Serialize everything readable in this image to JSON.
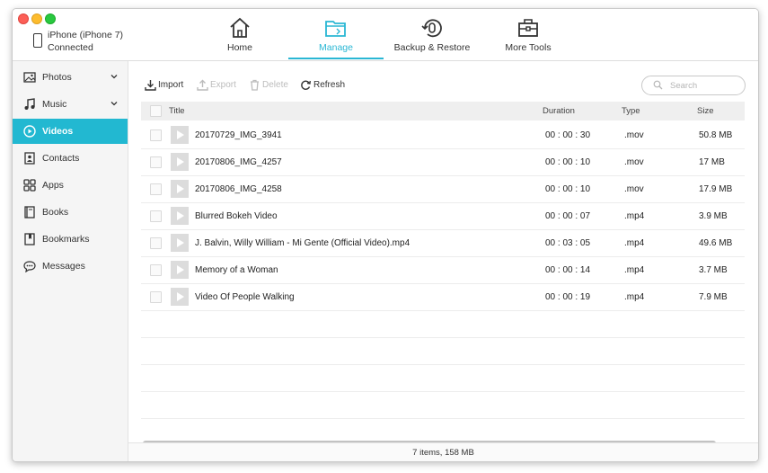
{
  "device": {
    "name": "iPhone (iPhone 7)",
    "status": "Connected"
  },
  "nav_tabs": [
    {
      "label": "Home",
      "icon": "home-icon"
    },
    {
      "label": "Manage",
      "icon": "folder-icon",
      "active": true
    },
    {
      "label": "Backup & Restore",
      "icon": "backup-restore-icon"
    },
    {
      "label": "More Tools",
      "icon": "toolbox-icon"
    }
  ],
  "sidebar": {
    "items": [
      {
        "label": "Photos",
        "icon": "photo-icon",
        "expandable": true
      },
      {
        "label": "Music",
        "icon": "music-icon",
        "expandable": true
      },
      {
        "label": "Videos",
        "icon": "play-icon",
        "active": true
      },
      {
        "label": "Contacts",
        "icon": "contacts-icon"
      },
      {
        "label": "Apps",
        "icon": "apps-icon"
      },
      {
        "label": "Books",
        "icon": "book-icon"
      },
      {
        "label": "Bookmarks",
        "icon": "bookmark-icon"
      },
      {
        "label": "Messages",
        "icon": "message-icon"
      }
    ]
  },
  "toolbar": {
    "import_label": "Import",
    "export_label": "Export",
    "delete_label": "Delete",
    "refresh_label": "Refresh",
    "search_placeholder": "Search"
  },
  "table": {
    "columns": {
      "title": "Title",
      "duration": "Duration",
      "type": "Type",
      "size": "Size"
    },
    "rows": [
      {
        "title": "20170729_IMG_3941",
        "duration": "00 : 00 : 30",
        "type": ".mov",
        "size": "50.8 MB"
      },
      {
        "title": "20170806_IMG_4257",
        "duration": "00 : 00 : 10",
        "type": ".mov",
        "size": "17 MB"
      },
      {
        "title": "20170806_IMG_4258",
        "duration": "00 : 00 : 10",
        "type": ".mov",
        "size": "17.9 MB"
      },
      {
        "title": "Blurred Bokeh Video",
        "duration": "00 : 00 : 07",
        "type": ".mp4",
        "size": "3.9 MB"
      },
      {
        "title": "J. Balvin, Willy William - Mi Gente (Official Video).mp4",
        "duration": "00 : 03 : 05",
        "type": ".mp4",
        "size": "49.6 MB"
      },
      {
        "title": "Memory of a Woman",
        "duration": "00 : 00 : 14",
        "type": ".mp4",
        "size": "3.7 MB"
      },
      {
        "title": "Video Of People Walking",
        "duration": "00 : 00 : 19",
        "type": ".mp4",
        "size": "7.9 MB"
      }
    ]
  },
  "status_bar": {
    "text": "7 items, 158 MB"
  },
  "colors": {
    "accent": "#22b8d1",
    "active_tab_text": "#2ab7d4"
  }
}
